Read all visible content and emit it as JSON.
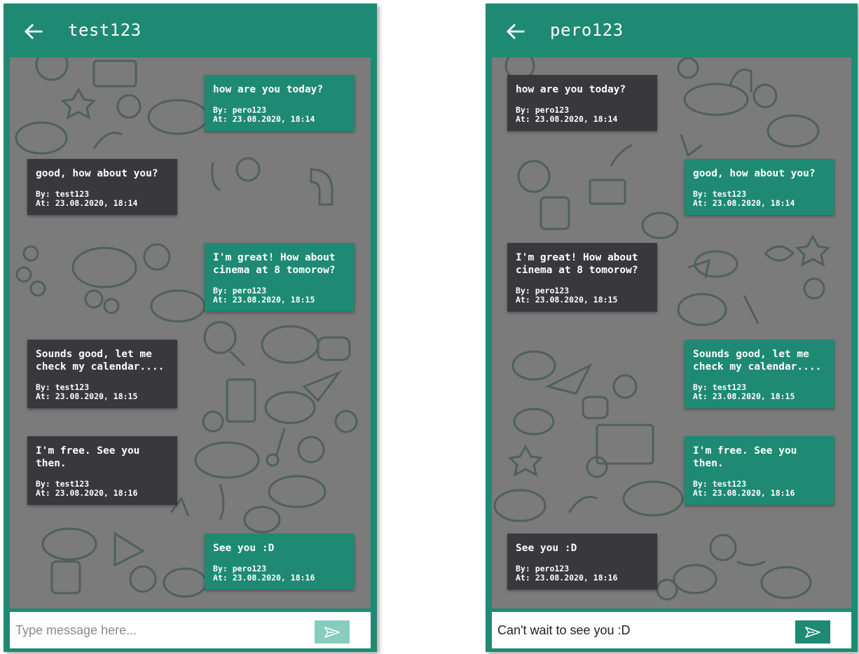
{
  "colors": {
    "accent": "#1e8a73",
    "bubble_dark": "#38383d",
    "background_pattern": "#7b7b7b"
  },
  "left_screen": {
    "title": "test123",
    "back_icon": "arrow-left-icon",
    "messages": [
      {
        "text": "how are you today?",
        "by": "By: pero123",
        "at": "At: 23.08.2020, 18:14"
      },
      {
        "text": "good, how about you?",
        "by": "By: test123",
        "at": "At: 23.08.2020, 18:14"
      },
      {
        "text": "I'm great! How about\ncinema at 8 tomorow?",
        "by": "By: pero123",
        "at": "At: 23.08.2020, 18:15"
      },
      {
        "text": "Sounds good, let me\ncheck my calendar....",
        "by": "By: test123",
        "at": "At: 23.08.2020, 18:15"
      },
      {
        "text": "I'm free. See you\nthen.",
        "by": "By: test123",
        "at": "At: 23.08.2020, 18:16"
      },
      {
        "text": "See you :D",
        "by": "By: pero123",
        "at": "At: 23.08.2020, 18:16"
      }
    ],
    "input": {
      "value": "",
      "placeholder": "Type message here..."
    },
    "send_icon": "send-icon"
  },
  "right_screen": {
    "title": "pero123",
    "back_icon": "arrow-left-icon",
    "messages": [
      {
        "text": "how are you today?",
        "by": "By: pero123",
        "at": "At: 23.08.2020, 18:14"
      },
      {
        "text": "good, how about you?",
        "by": "By: test123",
        "at": "At: 23.08.2020, 18:14"
      },
      {
        "text": "I'm great! How about\ncinema at 8 tomorow?",
        "by": "By: pero123",
        "at": "At: 23.08.2020, 18:15"
      },
      {
        "text": "Sounds good, let me\ncheck my calendar....",
        "by": "By: test123",
        "at": "At: 23.08.2020, 18:15"
      },
      {
        "text": "I'm free. See you\nthen.",
        "by": "By: test123",
        "at": "At: 23.08.2020, 18:16"
      },
      {
        "text": "See you :D",
        "by": "By: pero123",
        "at": "At: 23.08.2020, 18:16"
      }
    ],
    "input": {
      "value": "Can't wait to see you :D",
      "placeholder": "Type message here..."
    },
    "send_icon": "send-icon"
  }
}
